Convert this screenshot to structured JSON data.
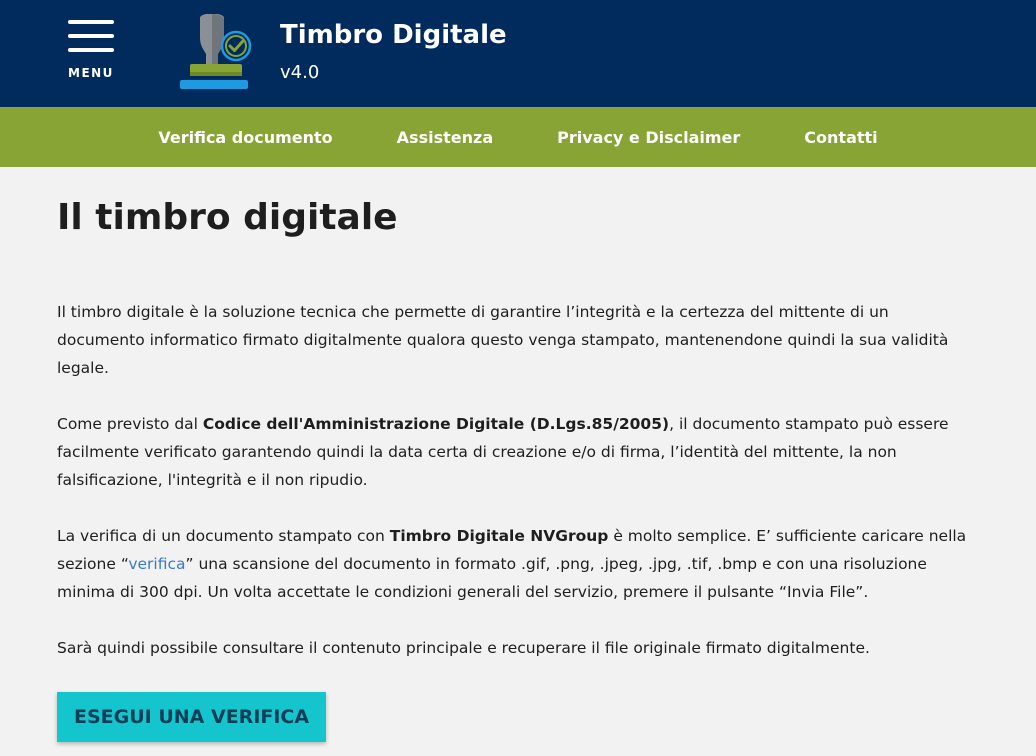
{
  "header": {
    "menu_label": "MENU",
    "app_title": "Timbro Digitale",
    "app_version": "v4.0",
    "logo_icon": "stamp-check-icon"
  },
  "nav": {
    "items": [
      {
        "label": "Verifica documento"
      },
      {
        "label": "Assistenza"
      },
      {
        "label": "Privacy e Disclaimer"
      },
      {
        "label": "Contatti"
      }
    ]
  },
  "main": {
    "title": "Il timbro digitale",
    "p1": "Il timbro digitale è la soluzione tecnica che permette di garantire l’integrità e la certezza del mittente di un documento informatico firmato digitalmente qualora questo venga stampato, mantenendone quindi la sua validità legale.",
    "p2_pre": "Come previsto dal ",
    "p2_bold": "Codice dell'Amministrazione Digitale (D.Lgs.85/2005)",
    "p2_post": ", il documento stampato può essere facilmente verificato garantendo quindi la data certa di creazione e/o di firma, l’identità del mittente, la non falsificazione, l'integrità e il non ripudio.",
    "p3_pre": "La verifica di un documento stampato con ",
    "p3_bold": "Timbro Digitale NVGroup",
    "p3_mid": " è molto semplice. E’ sufficiente caricare nella sezione “",
    "p3_link": "verifica",
    "p3_post": "” una scansione del documento in formato .gif, .png, .jpeg, .jpg, .tif, .bmp e con una risoluzione minima di 300 dpi. Un volta accettate le condizioni generali del servizio, premere il pulsante “Invia File”.",
    "p4": "Sarà quindi possibile consultare il contenuto principale e recuperare il file originale firmato digitalmente.",
    "cta_label": "ESEGUI UNA VERIFICA"
  },
  "colors": {
    "header_bg": "#002b5c",
    "nav_bg": "#87a434",
    "page_bg": "#f2f2f2",
    "cta_bg": "#15c5cd",
    "link": "#3b7ac9"
  }
}
